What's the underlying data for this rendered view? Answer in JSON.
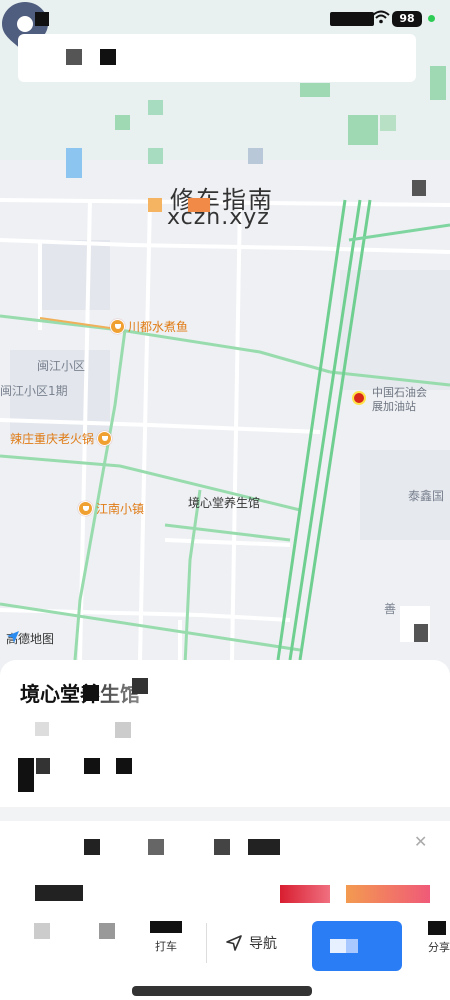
{
  "status_bar": {
    "battery": "98"
  },
  "map": {
    "watermark_title": "修车指南",
    "watermark_url": "xczn.xyz",
    "pois": [
      {
        "name": "川都水煮鱼"
      },
      {
        "name": "辣庄重庆老火锅"
      },
      {
        "name": "江南小镇"
      }
    ],
    "areas": [
      {
        "name": "闽江小区"
      },
      {
        "name": "闽江小区1期"
      },
      {
        "name": "泰鑫国"
      },
      {
        "name": "善"
      }
    ],
    "gas_station": "中国石油会\n展加油站",
    "selected_place": "境心堂养生馆",
    "logo_text": "高德地图"
  },
  "sheet": {
    "title": "境心堂养生馆",
    "close_icon": "close-icon",
    "accent_red": "#d81e30",
    "accent_orange": "#f39a50"
  },
  "bottom_bar": {
    "taxi_label": "打车",
    "nav_label": "导航",
    "share_label": "分享",
    "route_color": "#2a7df5"
  }
}
